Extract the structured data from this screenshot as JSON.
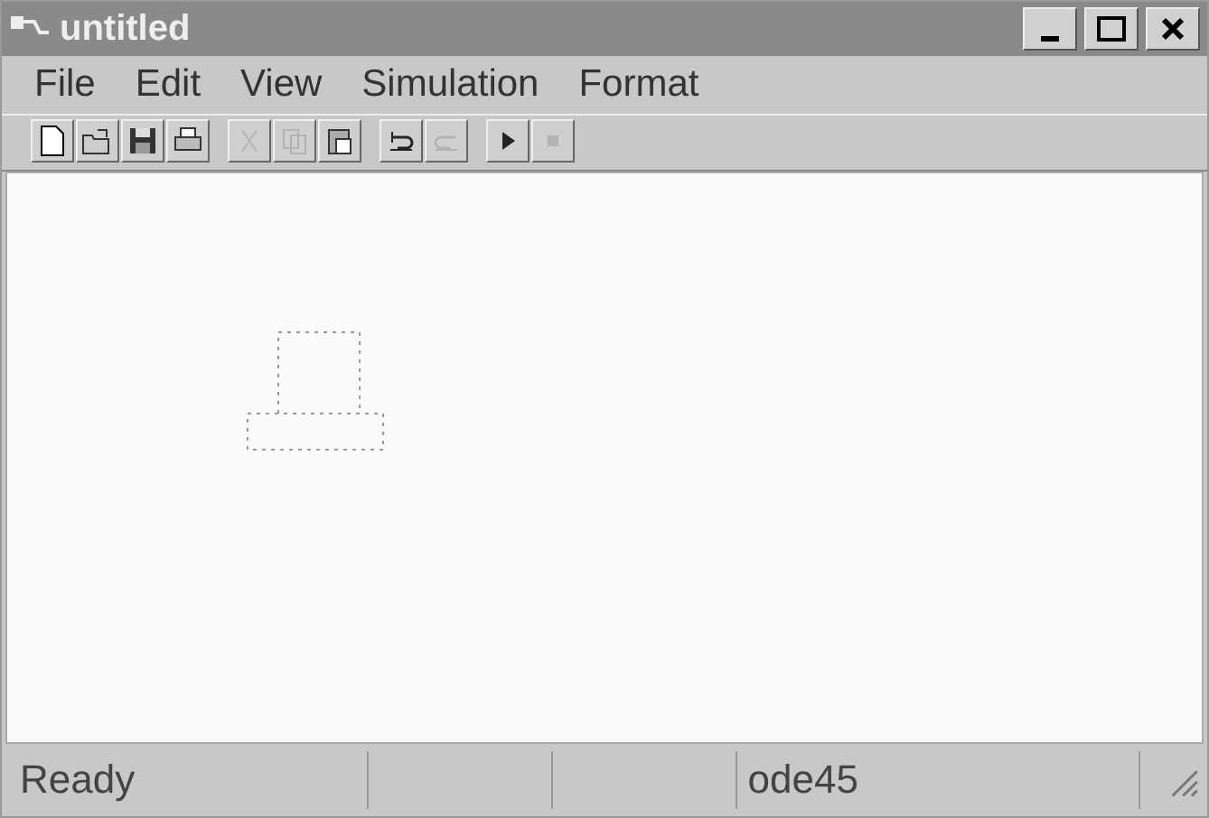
{
  "window": {
    "title": "untitled"
  },
  "menu": [
    "File",
    "Edit",
    "View",
    "Simulation",
    "Format"
  ],
  "toolbar": [
    {
      "kind": "new",
      "disabled": false
    },
    {
      "kind": "open",
      "disabled": false
    },
    {
      "kind": "save",
      "disabled": false
    },
    {
      "kind": "print",
      "disabled": false
    },
    {
      "kind": "sep"
    },
    {
      "kind": "cut",
      "disabled": true
    },
    {
      "kind": "copy",
      "disabled": true
    },
    {
      "kind": "paste",
      "disabled": false
    },
    {
      "kind": "sep"
    },
    {
      "kind": "undo",
      "disabled": false
    },
    {
      "kind": "redo",
      "disabled": true
    },
    {
      "kind": "sep"
    },
    {
      "kind": "start",
      "disabled": false
    },
    {
      "kind": "stop",
      "disabled": true
    }
  ],
  "status_bar": {
    "message": "Ready",
    "solver": "ode45"
  }
}
